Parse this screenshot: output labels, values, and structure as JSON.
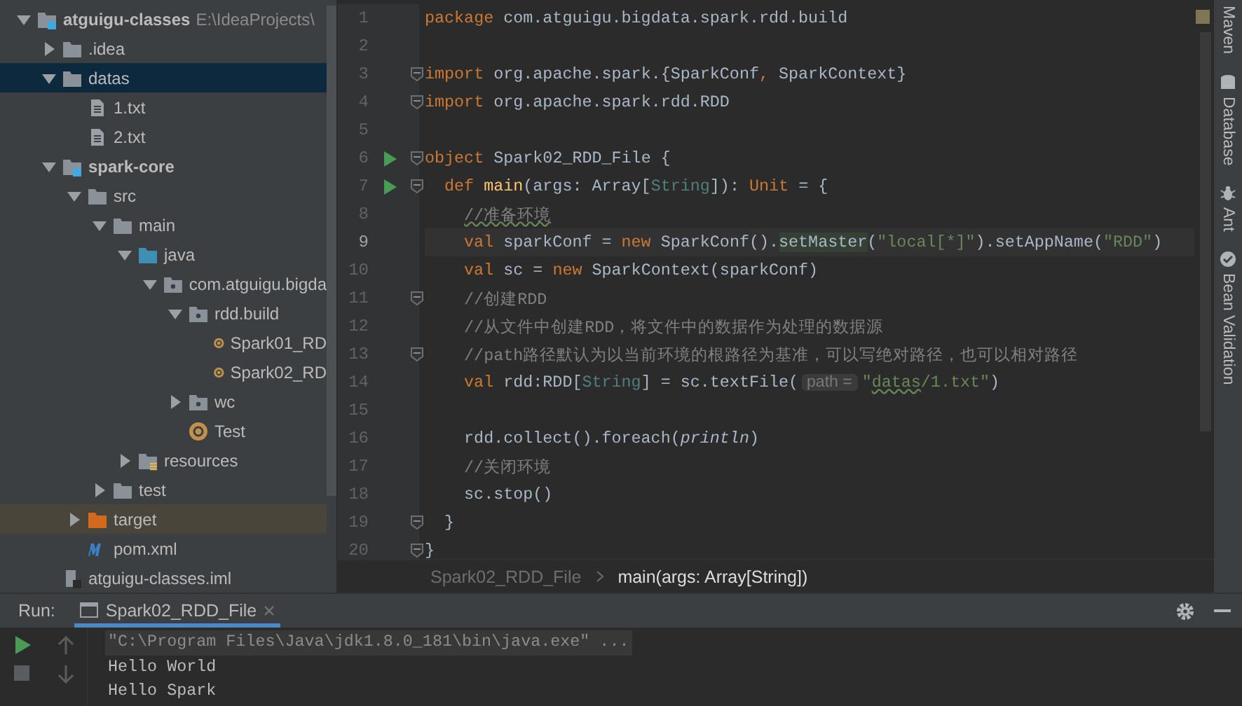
{
  "project_tree": {
    "items": [
      {
        "label": "atguigu-classes",
        "path": "E:\\IdeaProjects\\",
        "kind": "module",
        "expanded": true,
        "selected": false,
        "children": [
          {
            "label": ".idea",
            "kind": "folder",
            "expanded": false,
            "selected": false
          },
          {
            "label": "datas",
            "kind": "folder",
            "expanded": true,
            "selected": true,
            "children": [
              {
                "label": "1.txt",
                "kind": "text-file",
                "selected": false
              },
              {
                "label": "2.txt",
                "kind": "text-file",
                "selected": false
              }
            ]
          },
          {
            "label": "spark-core",
            "kind": "module",
            "expanded": true,
            "selected": false,
            "children": [
              {
                "label": "src",
                "kind": "folder",
                "expanded": true,
                "selected": false,
                "children": [
                  {
                    "label": "main",
                    "kind": "folder",
                    "expanded": true,
                    "selected": false,
                    "children": [
                      {
                        "label": "java",
                        "kind": "source-folder",
                        "expanded": true,
                        "selected": false,
                        "children": [
                          {
                            "label": "com.atguigu.bigda",
                            "kind": "package",
                            "expanded": true,
                            "selected": false,
                            "children": [
                              {
                                "label": "rdd.build",
                                "kind": "package",
                                "expanded": true,
                                "selected": false,
                                "children": [
                                  {
                                    "label": "Spark01_RD",
                                    "kind": "class",
                                    "selected": false
                                  },
                                  {
                                    "label": "Spark02_RD",
                                    "kind": "class",
                                    "selected": false
                                  }
                                ]
                              },
                              {
                                "label": "wc",
                                "kind": "package",
                                "expanded": false,
                                "selected": false
                              },
                              {
                                "label": "Test",
                                "kind": "class",
                                "selected": false
                              }
                            ]
                          }
                        ]
                      },
                      {
                        "label": "resources",
                        "kind": "resources-folder",
                        "expanded": false,
                        "selected": false
                      }
                    ]
                  },
                  {
                    "label": "test",
                    "kind": "folder",
                    "expanded": false,
                    "selected": false
                  }
                ]
              },
              {
                "label": "target",
                "kind": "excluded-folder",
                "expanded": false,
                "selected": false
              },
              {
                "label": "pom.xml",
                "kind": "maven-file",
                "selected": false
              }
            ]
          },
          {
            "label": "atguigu-classes.iml",
            "kind": "module-file",
            "selected": false
          }
        ]
      }
    ]
  },
  "editor": {
    "lines": [
      {
        "number": "1",
        "kind": "top",
        "current": false,
        "run": false,
        "fold": false,
        "tokens": [
          {
            "kind": "keyword",
            "text": "package "
          },
          {
            "kind": "plain",
            "text": "com.atguigu.bigdata.spark.rdd.build"
          }
        ]
      },
      {
        "number": "2",
        "kind": "top",
        "current": false,
        "run": false,
        "fold": false
      },
      {
        "number": "3",
        "kind": "top",
        "current": false,
        "run": false,
        "fold": true,
        "tokens": [
          {
            "kind": "keyword",
            "text": "import "
          },
          {
            "kind": "plain",
            "text": "org.apache.spark.{SparkConf"
          },
          {
            "kind": "keyword",
            "text": ", "
          },
          {
            "kind": "plain",
            "text": "SparkContext}"
          }
        ]
      },
      {
        "number": "4",
        "kind": "top",
        "current": false,
        "run": false,
        "fold": true,
        "tokens": [
          {
            "kind": "keyword",
            "text": "import "
          },
          {
            "kind": "plain",
            "text": "org.apache.spark.rdd.RDD"
          }
        ]
      },
      {
        "number": "5",
        "kind": "top",
        "current": false,
        "run": false,
        "fold": false
      },
      {
        "number": "6",
        "kind": "top",
        "current": false,
        "run": true,
        "fold": true,
        "tokens": [
          {
            "kind": "keyword",
            "text": "object "
          },
          {
            "kind": "plain",
            "text": "Spark02_RDD_File {"
          }
        ]
      },
      {
        "number": "7",
        "kind": "member",
        "current": false,
        "run": true,
        "fold": true,
        "tokens": [
          {
            "kind": "keyword",
            "text": "def "
          },
          {
            "kind": "function",
            "text": "main"
          },
          {
            "kind": "plain",
            "text": "(args: Array["
          },
          {
            "kind": "type",
            "text": "String"
          },
          {
            "kind": "plain",
            "text": "]): "
          },
          {
            "kind": "keyword",
            "text": "Unit "
          },
          {
            "kind": "plain",
            "text": "= {"
          }
        ]
      },
      {
        "number": "8",
        "kind": "body",
        "current": false,
        "run": false,
        "fold": false,
        "tokens": [
          {
            "kind": "typo-comment",
            "text": "//准备环境"
          }
        ]
      },
      {
        "number": "9",
        "kind": "body",
        "current": true,
        "run": false,
        "fold": false,
        "tokens": [
          {
            "kind": "keyword",
            "text": "val "
          },
          {
            "kind": "plain",
            "text": "sparkConf = "
          },
          {
            "kind": "keyword",
            "text": "new "
          },
          {
            "kind": "plain",
            "text": "SparkConf()."
          },
          {
            "kind": "marked",
            "text": "setMaster"
          },
          {
            "kind": "plain",
            "text": "("
          },
          {
            "kind": "string",
            "text": "\"local[*]\""
          },
          {
            "kind": "plain",
            "text": ").setAppName("
          },
          {
            "kind": "string",
            "text": "\"RDD\""
          },
          {
            "kind": "plain",
            "text": ")"
          }
        ]
      },
      {
        "number": "10",
        "kind": "body",
        "current": false,
        "run": false,
        "fold": false,
        "tokens": [
          {
            "kind": "keyword",
            "text": "val "
          },
          {
            "kind": "plain",
            "text": "sc = "
          },
          {
            "kind": "keyword",
            "text": "new "
          },
          {
            "kind": "plain",
            "text": "SparkContext(sparkConf)"
          }
        ]
      },
      {
        "number": "11",
        "kind": "body",
        "current": false,
        "run": false,
        "fold": true,
        "tokens": [
          {
            "kind": "comment",
            "text": "//创建RDD"
          }
        ]
      },
      {
        "number": "12",
        "kind": "body",
        "current": false,
        "run": false,
        "fold": false,
        "tokens": [
          {
            "kind": "comment",
            "text": "//从文件中创建RDD，将文件中的数据作为处理的数据源"
          }
        ]
      },
      {
        "number": "13",
        "kind": "body",
        "current": false,
        "run": false,
        "fold": true,
        "tokens": [
          {
            "kind": "comment",
            "text": "//path路径默认为以当前环境的根路径为基准，可以写绝对路径，也可以相对路径"
          }
        ]
      },
      {
        "number": "14",
        "kind": "body",
        "current": false,
        "run": false,
        "fold": false,
        "tokens": [
          {
            "kind": "keyword",
            "text": "val "
          },
          {
            "kind": "plain",
            "text": "rdd:RDD["
          },
          {
            "kind": "type",
            "text": "String"
          },
          {
            "kind": "plain",
            "text": "] = sc.textFile("
          },
          {
            "kind": "hint",
            "text": "path ="
          },
          {
            "kind": "string",
            "text": "\""
          },
          {
            "kind": "typo-string",
            "text": "datas"
          },
          {
            "kind": "string",
            "text": "/1.txt\""
          },
          {
            "kind": "plain",
            "text": ")"
          }
        ]
      },
      {
        "number": "15",
        "kind": "body",
        "current": false,
        "run": false,
        "fold": false
      },
      {
        "number": "16",
        "kind": "body",
        "current": false,
        "run": false,
        "fold": false,
        "tokens": [
          {
            "kind": "plain",
            "text": "rdd.collect().foreach("
          },
          {
            "kind": "italic",
            "text": "println"
          },
          {
            "kind": "plain",
            "text": ")"
          }
        ]
      },
      {
        "number": "17",
        "kind": "body",
        "current": false,
        "run": false,
        "fold": false,
        "tokens": [
          {
            "kind": "comment",
            "text": "//关闭环境"
          }
        ]
      },
      {
        "number": "18",
        "kind": "body",
        "current": false,
        "run": false,
        "fold": false,
        "tokens": [
          {
            "kind": "plain",
            "text": "sc.stop()"
          }
        ]
      },
      {
        "number": "19",
        "kind": "member",
        "current": false,
        "run": false,
        "fold": true,
        "tokens": [
          {
            "kind": "plain",
            "text": "}"
          }
        ]
      },
      {
        "number": "20",
        "kind": "top",
        "current": false,
        "run": false,
        "fold": true,
        "tokens": [
          {
            "kind": "plain",
            "text": "}"
          }
        ]
      }
    ]
  },
  "breadcrumb": [
    "Spark02_RDD_File",
    "main(args: Array[String])"
  ],
  "right_tool_strip": [
    "Maven",
    "Database",
    "Ant",
    "Bean Validation"
  ],
  "run_panel": {
    "label": "Run:",
    "tabs": [
      {
        "label": "Spark02_RDD_File",
        "selected": true
      }
    ],
    "output": [
      {
        "kind": "command",
        "text": "\"C:\\Program Files\\Java\\jdk1.8.0_181\\bin\\java.exe\" ..."
      },
      {
        "kind": "plain",
        "text": "Hello World"
      },
      {
        "kind": "plain",
        "text": "Hello Spark"
      }
    ]
  }
}
